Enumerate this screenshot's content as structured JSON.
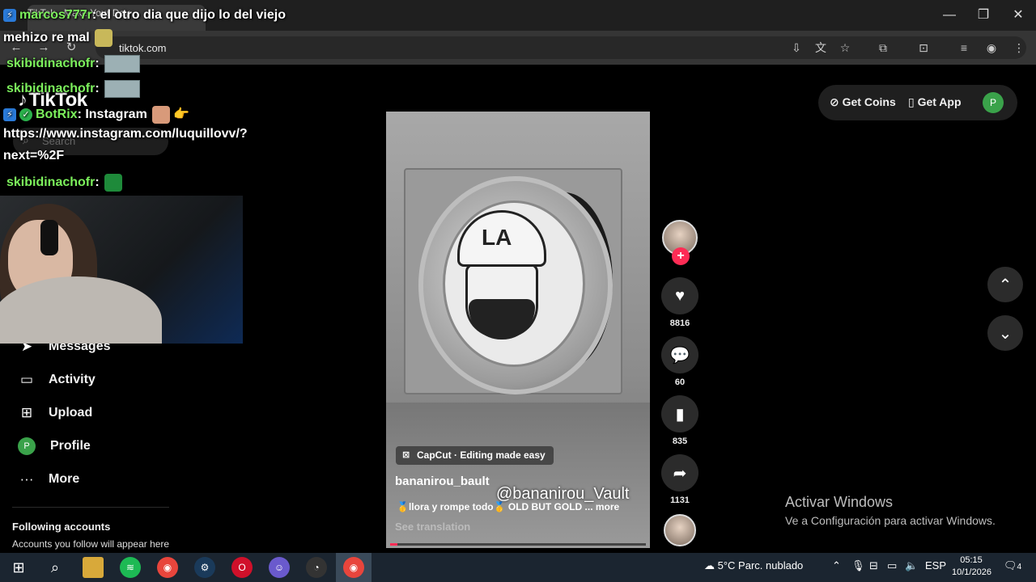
{
  "browser": {
    "tab_title": "TikTok - Make Your Day",
    "url": "tiktok.com"
  },
  "tiktok": {
    "logo": "TikTok",
    "search_placeholder": "Search",
    "nav": [
      {
        "label": "Messages",
        "icon": "send-icon"
      },
      {
        "label": "Activity",
        "icon": "activity-icon"
      },
      {
        "label": "Upload",
        "icon": "upload-icon"
      },
      {
        "label": "Profile",
        "icon": "profile-icon",
        "avatar_letter": "P"
      },
      {
        "label": "More",
        "icon": "more-icon"
      }
    ],
    "following_title": "Following accounts",
    "following_sub": "Accounts you follow will appear here",
    "top_right": {
      "get_coins": "Get Coins",
      "get_app": "Get App",
      "avatar_letter": "P"
    },
    "video": {
      "capcut_label": "CapCut · Editing made easy",
      "author": "bananirou_bault",
      "watermark": "@bananirou_Vault",
      "caption": "🥇llora y rompe todo🥇 OLD BUT GOLD ... more",
      "see_translation": "See translation",
      "cap_text": "LA",
      "progress": 0.03
    },
    "actions": {
      "likes": "8816",
      "comments": "60",
      "saves": "835",
      "shares": "1131"
    }
  },
  "windows_activation": {
    "title": "Activar Windows",
    "subtitle": "Ve a Configuración para activar Windows."
  },
  "chat": {
    "line1_user": "marcos777r",
    "line1_text": ": el otro dia que dijo lo del viejo",
    "line2_text": "mehizo re mal",
    "line3_user": "skibidinachofr",
    "line4_user": "skibidinachofr",
    "line5_user": "BotRix",
    "line5_text": ": Instagram",
    "line6_text": "https://www.instagram.com/luquillovv/?",
    "line7_text": "next=%2F",
    "line8_user": "skibidinachofr",
    "sep": ":"
  },
  "taskbar": {
    "weather": "5°C  Parc. nublado",
    "lang": "ESP",
    "time": "05:15",
    "date": "10/1/2026",
    "notifications": "4"
  },
  "colors": {
    "accent": "#fe2c55",
    "chat_user": "#7cf05c",
    "profile_green": "#3aa24a"
  }
}
